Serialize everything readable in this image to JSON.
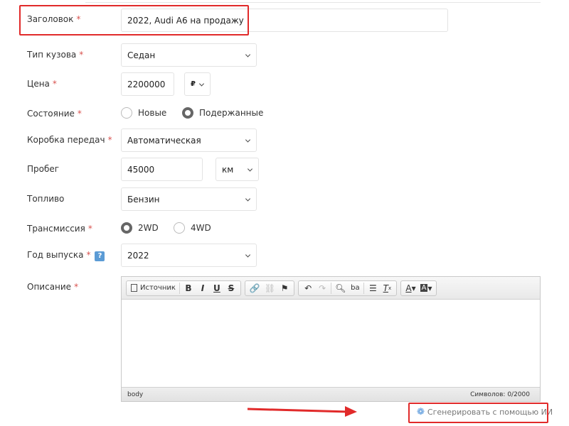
{
  "form": {
    "title": {
      "label": "Заголовок",
      "required": "*",
      "value": "2022, Audi A6 на продажу"
    },
    "body_type": {
      "label": "Тип кузова",
      "required": "*",
      "value": "Седан"
    },
    "price": {
      "label": "Цена",
      "required": "*",
      "value": "2200000",
      "currency": "₽"
    },
    "condition": {
      "label": "Состояние",
      "required": "*",
      "options": [
        "Новые",
        "Подержанные"
      ],
      "selected": "Подержанные"
    },
    "gearbox": {
      "label": "Коробка передач",
      "required": "*",
      "value": "Автоматическая"
    },
    "mileage": {
      "label": "Пробег",
      "value": "45000",
      "unit": "км"
    },
    "fuel": {
      "label": "Топливо",
      "value": "Бензин"
    },
    "drive": {
      "label": "Трансмиссия",
      "required": "*",
      "options": [
        "2WD",
        "4WD"
      ],
      "selected": "2WD"
    },
    "year": {
      "label": "Год выпуска",
      "required": "*",
      "help": "?",
      "value": "2022"
    },
    "description": {
      "label": "Описание",
      "required": "*",
      "source_label": "Источник",
      "path": "body",
      "counter": "Символов: 0/2000"
    }
  },
  "ai_button": {
    "label": "Сгенерировать с помощью ИИ",
    "icon": "openai-icon"
  },
  "colors": {
    "highlight": "#e12a2a",
    "accent": "#5b9bd5"
  }
}
